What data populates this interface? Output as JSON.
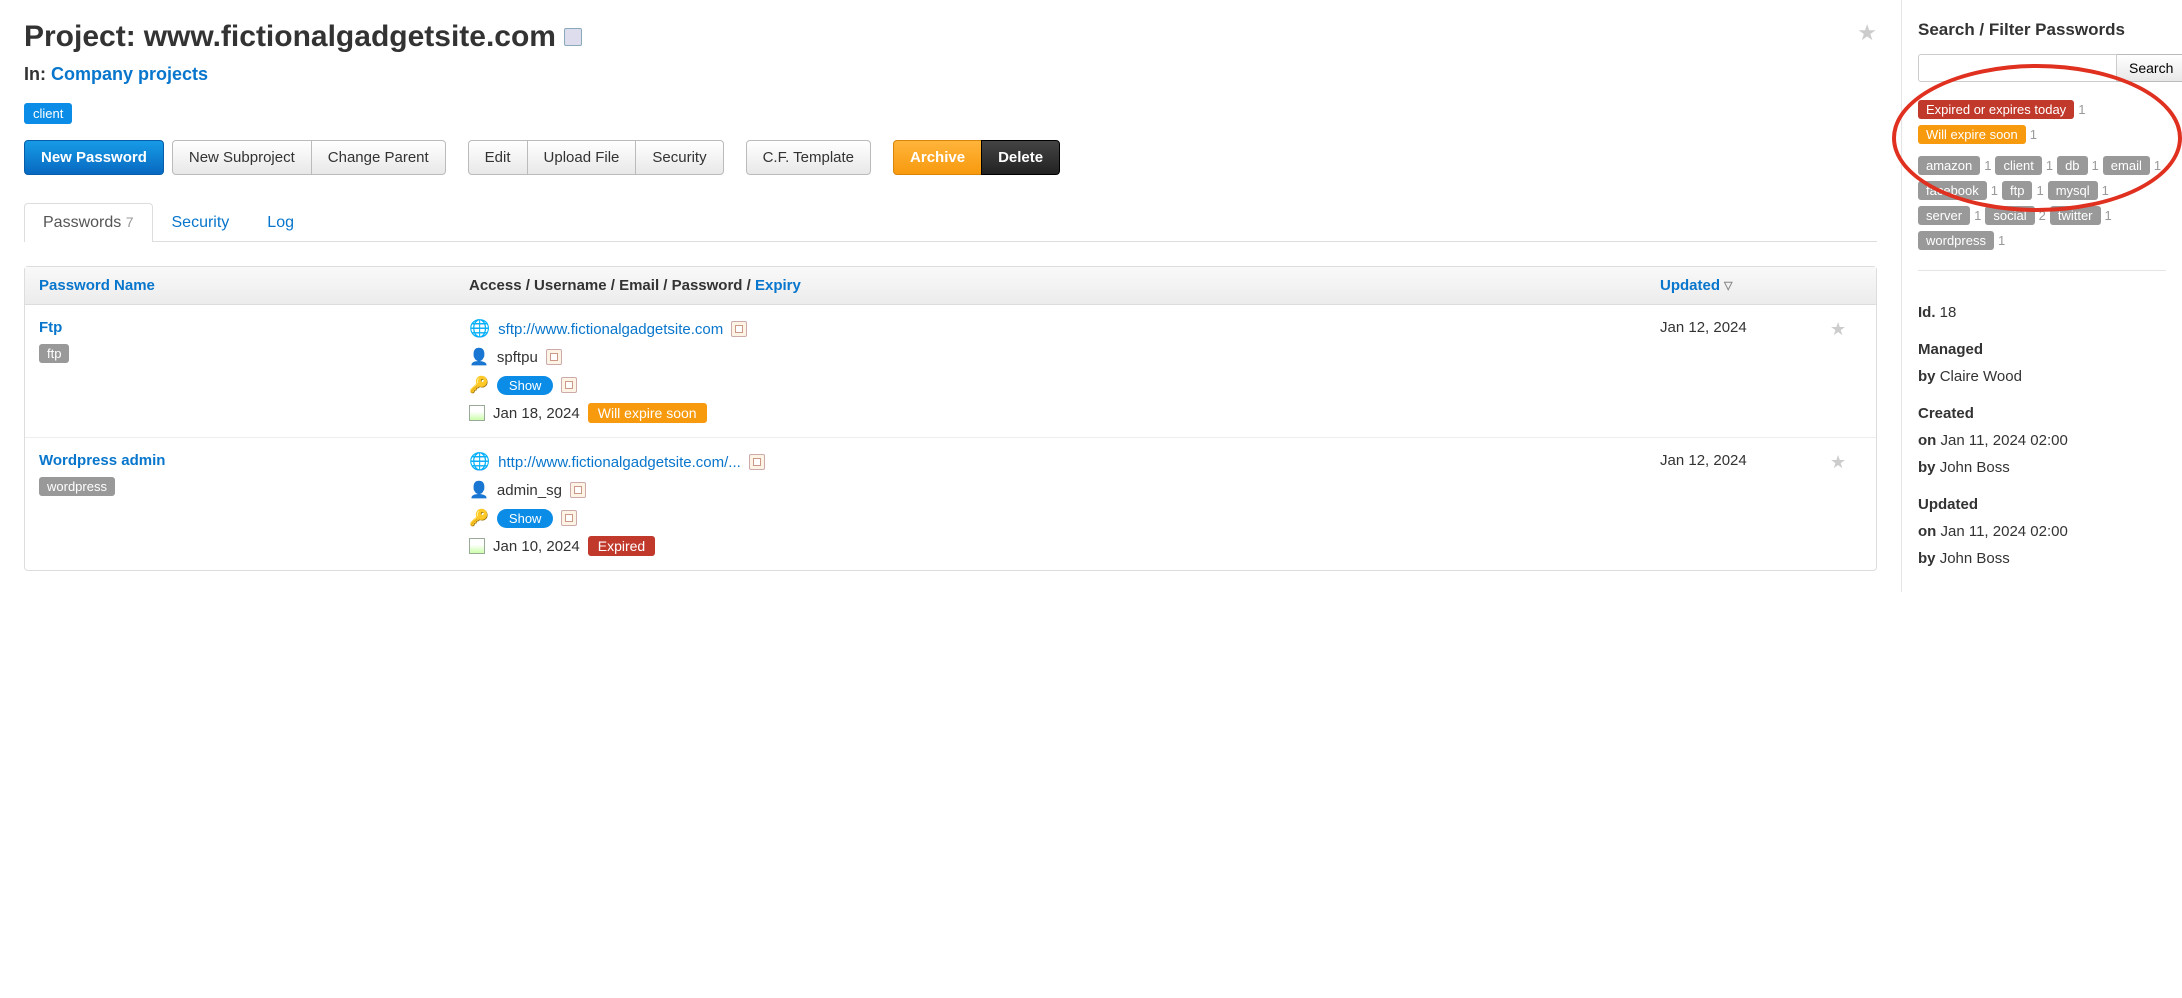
{
  "project": {
    "title_prefix": "Project:",
    "title_name": "www.fictionalgadgetsite.com",
    "breadcrumb_in": "In:",
    "breadcrumb_link": "Company projects",
    "client_tag": "client"
  },
  "toolbar": {
    "new_password": "New Password",
    "new_subproject": "New Subproject",
    "change_parent": "Change Parent",
    "edit": "Edit",
    "upload_file": "Upload File",
    "security": "Security",
    "cf_template": "C.F. Template",
    "archive": "Archive",
    "delete": "Delete"
  },
  "tabs": {
    "passwords_label": "Passwords",
    "passwords_count": "7",
    "security": "Security",
    "log": "Log"
  },
  "table": {
    "headers": {
      "name": "Password Name",
      "access_prefix": "Access / Username / Email / Password /",
      "access_expiry": "Expiry",
      "updated": "Updated"
    },
    "rows": [
      {
        "name": "Ftp",
        "tags": [
          {
            "label": "ftp"
          }
        ],
        "url": "sftp://www.fictionalgadgetsite.com",
        "username": "spftpu",
        "show_label": "Show",
        "expiry_date": "Jan 18, 2024",
        "expiry_badge": "Will expire soon",
        "expiry_badge_type": "orange",
        "updated": "Jan 12, 2024"
      },
      {
        "name": "Wordpress admin",
        "tags": [
          {
            "label": "wordpress"
          }
        ],
        "url": "http://www.fictionalgadgetsite.com/...",
        "username": "admin_sg",
        "show_label": "Show",
        "expiry_date": "Jan 10, 2024",
        "expiry_badge": "Expired",
        "expiry_badge_type": "red",
        "updated": "Jan 12, 2024"
      }
    ]
  },
  "sidebar": {
    "filter_title": "Search / Filter Passwords",
    "search_button": "Search",
    "filters": [
      {
        "label": "Expired or expires today",
        "count": "1",
        "type": "red"
      },
      {
        "label": "Will expire soon",
        "count": "1",
        "type": "orange"
      },
      {
        "label": "amazon",
        "count": "1",
        "type": "gray"
      },
      {
        "label": "client",
        "count": "1",
        "type": "gray"
      },
      {
        "label": "db",
        "count": "1",
        "type": "gray"
      },
      {
        "label": "email",
        "count": "1",
        "type": "gray"
      },
      {
        "label": "facebook",
        "count": "1",
        "type": "gray"
      },
      {
        "label": "ftp",
        "count": "1",
        "type": "gray"
      },
      {
        "label": "mysql",
        "count": "1",
        "type": "gray"
      },
      {
        "label": "server",
        "count": "1",
        "type": "gray"
      },
      {
        "label": "social",
        "count": "2",
        "type": "gray"
      },
      {
        "label": "twitter",
        "count": "1",
        "type": "gray"
      },
      {
        "label": "wordpress",
        "count": "1",
        "type": "gray"
      }
    ],
    "meta": {
      "id_label": "Id.",
      "id_value": "18",
      "managed_label": "Managed",
      "managed_by_prefix": "by",
      "managed_by": "Claire Wood",
      "created_label": "Created",
      "on_prefix": "on",
      "created_on": "Jan 11, 2024 02:00",
      "created_by_prefix": "by",
      "created_by": "John Boss",
      "updated_label": "Updated",
      "updated_on": "Jan 11, 2024 02:00",
      "updated_by_prefix": "by",
      "updated_by": "John Boss"
    }
  }
}
